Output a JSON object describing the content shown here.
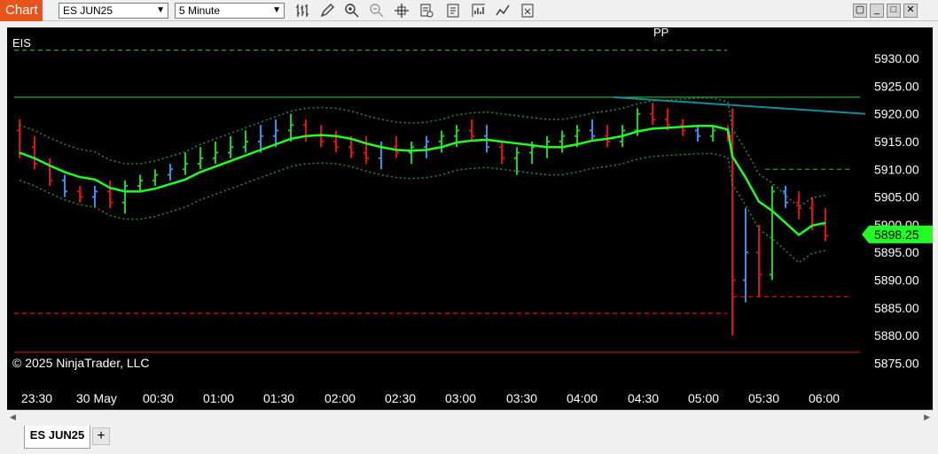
{
  "toolbar": {
    "chart_label": "Chart",
    "instrument": "ES JUN25",
    "timeframe": "5 Minute",
    "icons": [
      "bar-type-icon",
      "drawing-tool-icon",
      "zoom-in-icon",
      "zoom-out-icon",
      "crosshair-icon",
      "data-box-icon",
      "properties-icon",
      "indicators-icon",
      "strategies-icon",
      "templates-icon"
    ],
    "window_buttons": [
      "▢",
      "_",
      "□",
      "✕"
    ]
  },
  "chart": {
    "symbol_label": "EIS",
    "pivot_label": "PP",
    "copyright": "© 2025 NinjaTrader, LLC",
    "current_price": "5898.25",
    "price_ticks": [
      "5930.00",
      "5925.00",
      "5920.00",
      "5915.00",
      "5910.00",
      "5905.00",
      "5900.00",
      "5895.00",
      "5890.00",
      "5885.00",
      "5880.00",
      "5875.00"
    ],
    "time_ticks": [
      "23:30",
      "30 May",
      "00:30",
      "01:00",
      "01:30",
      "02:00",
      "02:30",
      "03:00",
      "03:30",
      "04:00",
      "04:30",
      "05:00",
      "05:30",
      "06:00"
    ],
    "colors": {
      "up": "#20d020",
      "down": "#e01010",
      "blue": "#3a8ee8",
      "sma": "#22ff22",
      "band": "#2f8a2f",
      "trend": "#1a8a9a",
      "price_tag": "#22ff22"
    }
  },
  "chart_data": {
    "type": "bar",
    "instrument": "ES JUN25",
    "interval": "5 Minute",
    "ylim": [
      5873,
      5934
    ],
    "series": [
      {
        "name": "price",
        "values": [
          [
            5917,
            5919,
            5912,
            5913
          ],
          [
            5914,
            5916,
            5910,
            5911
          ],
          [
            5911,
            5912,
            5907,
            5908
          ],
          [
            5908,
            5909,
            5905,
            5906
          ],
          [
            5906,
            5907,
            5904,
            5905
          ],
          [
            5905,
            5907,
            5903,
            5906
          ],
          [
            5906,
            5908,
            5903,
            5904
          ],
          [
            5904,
            5908,
            5902,
            5907
          ],
          [
            5907,
            5909,
            5906,
            5908
          ],
          [
            5908,
            5910,
            5907,
            5909
          ],
          [
            5909,
            5911,
            5908,
            5910
          ],
          [
            5910,
            5913,
            5909,
            5911
          ],
          [
            5911,
            5914,
            5910,
            5912
          ],
          [
            5912,
            5915,
            5911,
            5913
          ],
          [
            5913,
            5916,
            5912,
            5914
          ],
          [
            5914,
            5917,
            5913,
            5915
          ],
          [
            5915,
            5918,
            5913,
            5916
          ],
          [
            5916,
            5919,
            5914,
            5917
          ],
          [
            5917,
            5920,
            5915,
            5918
          ],
          [
            5918,
            5919,
            5915,
            5916
          ],
          [
            5916,
            5918,
            5914,
            5915
          ],
          [
            5915,
            5917,
            5913,
            5914
          ],
          [
            5914,
            5916,
            5912,
            5913
          ],
          [
            5913,
            5916,
            5911,
            5912
          ],
          [
            5912,
            5915,
            5910,
            5914
          ],
          [
            5914,
            5916,
            5912,
            5913
          ],
          [
            5913,
            5915,
            5911,
            5914
          ],
          [
            5914,
            5916,
            5912,
            5915
          ],
          [
            5915,
            5917,
            5913,
            5916
          ],
          [
            5916,
            5918,
            5914,
            5917
          ],
          [
            5917,
            5919,
            5915,
            5916
          ],
          [
            5916,
            5918,
            5913,
            5914
          ],
          [
            5914,
            5915,
            5911,
            5912
          ],
          [
            5912,
            5914,
            5909,
            5913
          ],
          [
            5913,
            5915,
            5911,
            5914
          ],
          [
            5914,
            5916,
            5912,
            5915
          ],
          [
            5915,
            5917,
            5913,
            5916
          ],
          [
            5916,
            5918,
            5914,
            5917
          ],
          [
            5917,
            5919,
            5915,
            5916
          ],
          [
            5916,
            5918,
            5914,
            5915
          ],
          [
            5915,
            5918,
            5914,
            5917
          ],
          [
            5917,
            5921,
            5916,
            5920
          ],
          [
            5920,
            5922,
            5918,
            5919
          ],
          [
            5919,
            5921,
            5917,
            5918
          ],
          [
            5918,
            5919,
            5916,
            5917
          ],
          [
            5917,
            5918,
            5915,
            5916
          ],
          [
            5916,
            5918,
            5915,
            5917
          ],
          [
            5917,
            5918,
            5915,
            5916
          ],
          [
            5916,
            5921,
            5880,
            5890
          ],
          [
            5890,
            5903,
            5886,
            5895
          ],
          [
            5895,
            5900,
            5887,
            5891
          ],
          [
            5891,
            5907,
            5890,
            5906
          ],
          [
            5906,
            5907,
            5903,
            5904
          ],
          [
            5904,
            5906,
            5901,
            5903
          ],
          [
            5903,
            5905,
            5899,
            5900
          ],
          [
            5900,
            5903,
            5897,
            5898
          ]
        ]
      }
    ]
  }
}
